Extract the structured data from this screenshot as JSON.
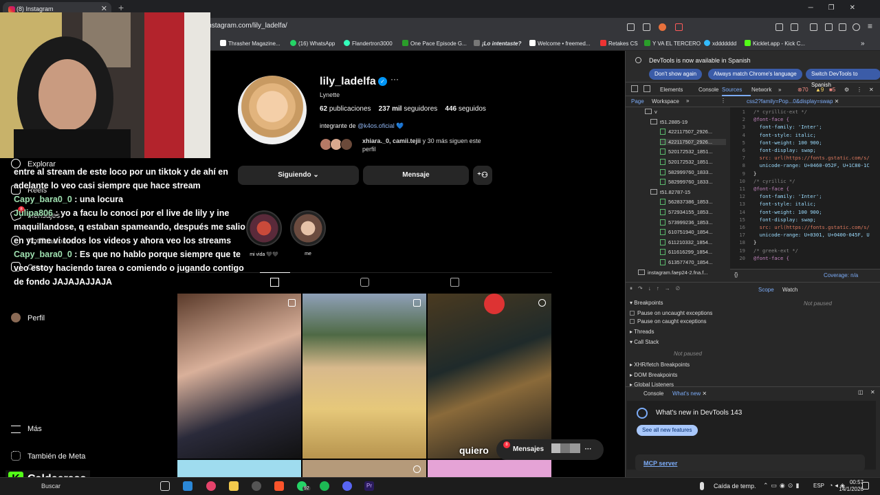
{
  "browser": {
    "tab_title": "(8) Instagram",
    "url": "instagram.com/lily_ladelfa/",
    "bookmarks": [
      "Thrasher Magazine...",
      "(16) WhatsApp",
      "Flandertron3000",
      "One Pace Episode G...",
      "¡Lo intentaste?",
      "Welcome • freemed...",
      "Retakes CS",
      "Y VA EL TERCERO",
      "xddddddd",
      "Kicklet.app - Kick C..."
    ]
  },
  "sidebar": {
    "items": [
      "Explorar",
      "Reels",
      "Mensajes",
      "Notificaciones",
      "Crear",
      "Perfil"
    ],
    "messages_badge": "8",
    "more": "Más",
    "meta": "También de Meta"
  },
  "profile": {
    "username": "lily_ladelfa",
    "verified_glyph": "✓",
    "options_glyph": "···",
    "full_name": "Lynette",
    "posts_count": "62",
    "posts_label": "publicaciones",
    "followers_count": "237 mil",
    "followers_label": "seguidores",
    "following_count": "446",
    "following_label": "seguidos",
    "bio_prefix": "integrante de",
    "bio_link": "@k4os.oficial",
    "bio_emoji": "💙",
    "followed_by_names": "xhiara._0, camii.tejii",
    "followed_by_rest": "y 30 más siguen este perfil",
    "following_button": "Siguiendo",
    "message_button": "Mensaje",
    "highlights": [
      {
        "label": "mi vida 🖤🖤"
      },
      {
        "label": "me"
      }
    ]
  },
  "posts_overlay_text": "quiero",
  "messages_bar": {
    "label": "Mensajes",
    "badge": "8"
  },
  "chat": [
    {
      "user": "",
      "text": "entre al stream de este loco por un tiktok y de ahí en adelante lo veo casi siempre que hace stream"
    },
    {
      "user": "Capy_bara0_0",
      "text": ": una locura"
    },
    {
      "user": "Julipa806",
      "text": ": yo a facu lo conocí por el live de lily y ine maquillandose, q estaban spameando, después me salio en yt, me vi todos los videos y ahora veo los streams"
    },
    {
      "user": "Capy_bara0_0",
      "text": ": Es que no hablo porque siempre que te veo estoy haciendo tarea o comiendo o jugando contigo de fondo JAJAJAJJAJA"
    }
  ],
  "stream_name": "Caldeerass",
  "devtools": {
    "info_message": "DevTools is now available in Spanish",
    "btn_dont_show": "Don't show again",
    "btn_match": "Always match Chrome's language",
    "btn_switch": "Switch DevTools to Spanish",
    "tabs": [
      "Elements",
      "Console",
      "Sources",
      "Network"
    ],
    "errors": "70",
    "warnings": "9",
    "issues": "5",
    "page_tab": "Page",
    "workspace_tab": "Workspace",
    "open_file": "css2?family=Pop...0&display=swap",
    "tree": [
      {
        "label": "v",
        "type": "folder"
      },
      {
        "label": "t51.2885-19",
        "type": "folder"
      },
      {
        "label": "422117507_2926...",
        "type": "file"
      },
      {
        "label": "422117507_2926...",
        "type": "file"
      },
      {
        "label": "520172532_1851...",
        "type": "file"
      },
      {
        "label": "520172532_1851...",
        "type": "file"
      },
      {
        "label": "582999760_1833...",
        "type": "file"
      },
      {
        "label": "582999760_1833...",
        "type": "file"
      },
      {
        "label": "t51.82787-15",
        "type": "folder"
      },
      {
        "label": "562837386_1853...",
        "type": "file"
      },
      {
        "label": "572934155_1853...",
        "type": "file"
      },
      {
        "label": "573999236_1853...",
        "type": "file"
      },
      {
        "label": "610751940_1854...",
        "type": "file"
      },
      {
        "label": "611210332_1854...",
        "type": "file"
      },
      {
        "label": "611616299_1854...",
        "type": "file"
      },
      {
        "label": "613577470_1854...",
        "type": "file"
      },
      {
        "label": "instagram.faep24-2.fna.f...",
        "type": "cloud"
      }
    ],
    "code": [
      "/* cyrillic-ext */",
      "@font-face {",
      "  font-family: 'Inter';",
      "  font-style: italic;",
      "  font-weight: 100 900;",
      "  font-display: swap;",
      "  src: url(https://fonts.gstatic.com/s/",
      "  unicode-range: U+0460-052F, U+1C80-1C",
      "}",
      "/* cyrillic */",
      "@font-face {",
      "  font-family: 'Inter';",
      "  font-style: italic;",
      "  font-weight: 100 900;",
      "  font-display: swap;",
      "  src: url(https://fonts.gstatic.com/s/",
      "  unicode-range: U+0301, U+0400-045F, U",
      "}",
      "/* greek-ext */",
      "@font-face {"
    ],
    "coverage": "Coverage: n/a",
    "breakpoints": "Breakpoints",
    "pause_uncaught": "Pause on uncaught exceptions",
    "pause_caught": "Pause on caught exceptions",
    "threads": "Threads",
    "call_stack": "Call Stack",
    "not_paused": "Not paused",
    "xhr": "XHR/fetch Breakpoints",
    "dom": "DOM Breakpoints",
    "global": "Global Listeners",
    "scope": "Scope",
    "watch": "Watch",
    "drawer_console": "Console",
    "drawer_whatsnew": "What's new",
    "whats_new_title": "What's new in DevTools 143",
    "see_all": "See all new features",
    "mcp": "MCP server"
  },
  "taskbar": {
    "search_text": "Buscar",
    "whatsapp_badge": "92",
    "weather": "Caída de temp.",
    "lang": "ESP",
    "time": "00:57",
    "date": "14/1/2026"
  }
}
